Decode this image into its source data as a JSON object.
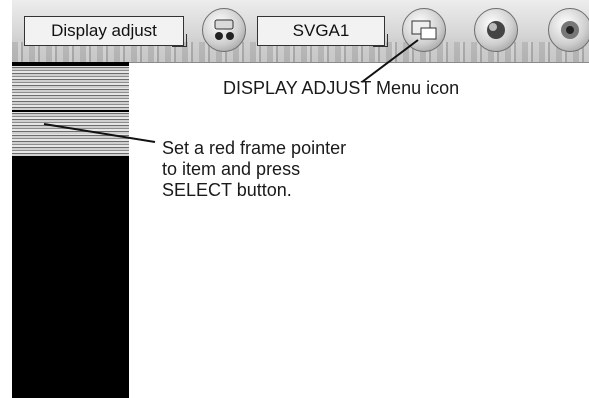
{
  "menubar": {
    "tab_display": "Display adjust",
    "tab_svga": "SVGA1",
    "icons": [
      "input-icon",
      "display-adjust-icon",
      "image-icon",
      "sound-icon"
    ]
  },
  "annotations": {
    "display_adjust_icon": "DISPLAY ADJUST Menu icon",
    "instruction_line1": "Set a red frame pointer",
    "instruction_line2": "to item and press",
    "instruction_line3": "SELECT button."
  }
}
